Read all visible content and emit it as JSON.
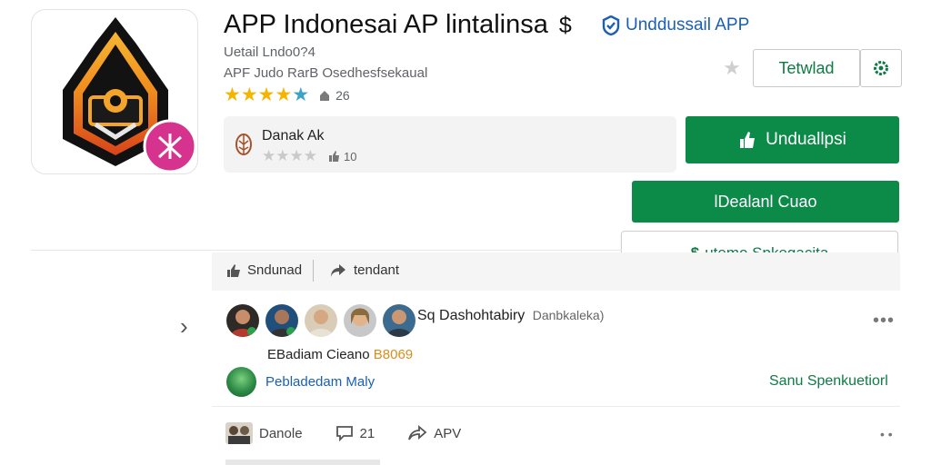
{
  "app": {
    "title": "APP Indonesai AP lintalinsa",
    "title_symbol": "$",
    "developer_link": "Unddussail APP",
    "meta_line1": "Uetail Lndo0?4",
    "meta_line2": "APF Judo RarB Osedhesfsekaual",
    "rating_count": "26",
    "icon_name": "shield-logo-icon"
  },
  "top_actions": {
    "wishlist_icon": "star-icon",
    "outline_label": "Tetwlad",
    "settings_icon": "gear-icon"
  },
  "review_card": {
    "name": "Danak Ak",
    "count": "10"
  },
  "buttons": {
    "install": "Unduallpsi",
    "secondary": "lDealanl Cuao",
    "outline_wide": "utemo Spkegacita"
  },
  "stats": {
    "item1": "Sndunad",
    "item2": "tendant"
  },
  "post": {
    "title": "Sq Dashohtabiry",
    "title_sub": "Danbkaleka)",
    "subline": "EBadiam Cieano",
    "subline_num": "B8069",
    "publisher": "Pebladedam Maly",
    "publisher_link": "Sanu Spenkuetiorl",
    "more": "•••"
  },
  "footer": {
    "author": "Danole",
    "comments": "21",
    "share": "APV",
    "more": "• •"
  },
  "colors": {
    "primary_green": "#0c8a47",
    "link_blue": "#1a5fb4",
    "star_gold": "#f4b400"
  }
}
